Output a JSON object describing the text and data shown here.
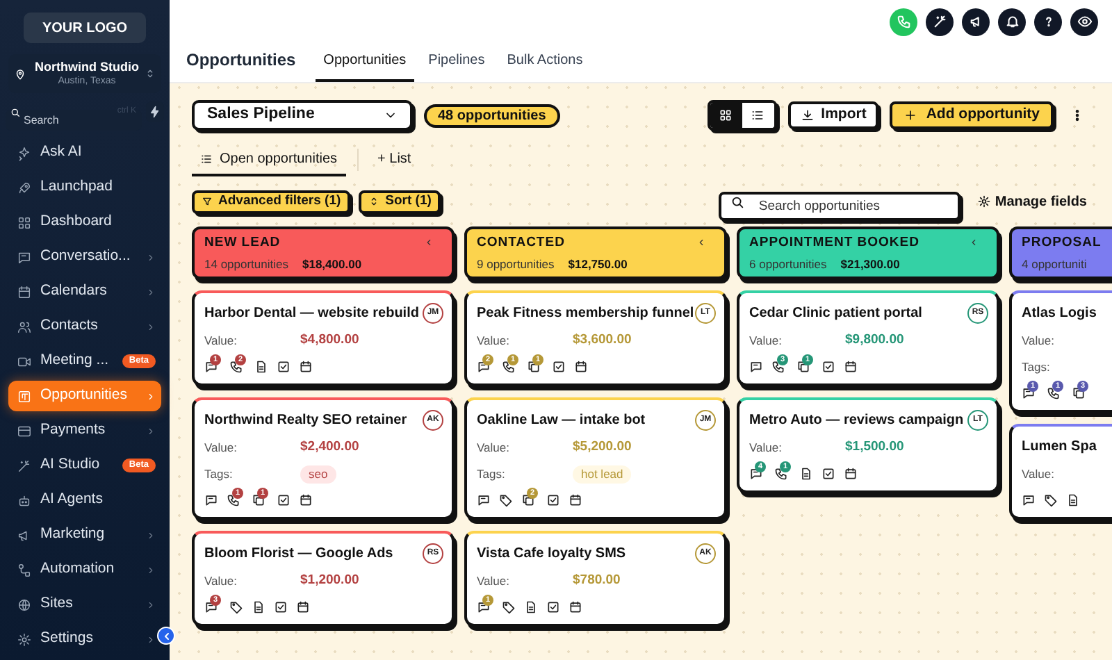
{
  "sidebar": {
    "logo": "YOUR LOGO",
    "location": {
      "name": "Northwind Studio",
      "address": "Austin, Texas"
    },
    "search": {
      "placeholder": "Search",
      "shortcut": "ctrl K"
    },
    "items": [
      {
        "label": "Ask AI",
        "chevron": false,
        "selected": false
      },
      {
        "label": "Launchpad",
        "chevron": false,
        "selected": false
      },
      {
        "label": "Dashboard",
        "chevron": false,
        "selected": false
      },
      {
        "label": "Conversatio...",
        "chevron": true,
        "selected": false
      },
      {
        "label": "Calendars",
        "chevron": true,
        "selected": false
      },
      {
        "label": "Contacts",
        "chevron": true,
        "selected": false
      },
      {
        "label": "Meeting ...",
        "chevron": false,
        "badge": "Beta",
        "selected": false
      },
      {
        "label": "Opportunities",
        "chevron": true,
        "selected": true
      },
      {
        "label": "Payments",
        "chevron": true,
        "selected": false
      },
      {
        "label": "AI Studio",
        "chevron": false,
        "badge": "Beta",
        "selected": false
      },
      {
        "label": "AI Agents",
        "chevron": false,
        "selected": false
      },
      {
        "label": "Marketing",
        "chevron": true,
        "selected": false
      },
      {
        "label": "Automation",
        "chevron": true,
        "selected": false
      },
      {
        "label": "Sites",
        "chevron": true,
        "selected": false
      },
      {
        "label": "Settings",
        "chevron": true,
        "selected": false
      }
    ]
  },
  "top_actions": [
    {
      "color": "#22c55e"
    },
    {
      "color": "#111827"
    },
    {
      "color": "#111827"
    },
    {
      "color": "#111827"
    },
    {
      "color": "#111827"
    },
    {
      "color": "#111827"
    }
  ],
  "page_title": "Opportunities",
  "tabs": [
    {
      "label": "Opportunities",
      "selected": true
    },
    {
      "label": "Pipelines",
      "selected": false
    },
    {
      "label": "Bulk Actions",
      "selected": false
    }
  ],
  "pipeline_select": "Sales Pipeline",
  "count_badge": "48 opportunities",
  "view_toggle": [
    {
      "selected": true
    },
    {
      "selected": false
    }
  ],
  "import_button": "Import",
  "add_button": "Add opportunity",
  "list_tabs": [
    {
      "label": "Open opportunities",
      "selected": true
    },
    {
      "label": "+ List",
      "selected": false
    }
  ],
  "filters": [
    "Advanced filters (1)",
    "Sort (1)"
  ],
  "search": {
    "placeholder": "Search opportunities"
  },
  "manage_fields": "Manage fields",
  "columns": [
    {
      "title": "NEW LEAD",
      "count": "14 opportunities",
      "total": "$18,400.00",
      "color": "#f85a5a",
      "cards": [
        {
          "title": "Harbor Dental — website rebuild",
          "owner": "JM",
          "value_label": "Value:",
          "value": "$4,800.00",
          "icons": [
            {
              "kind": "chat",
              "count": "1"
            },
            {
              "kind": "phone",
              "count": "2"
            },
            {
              "kind": "doc"
            },
            {
              "kind": "task"
            },
            {
              "kind": "calendar"
            }
          ]
        },
        {
          "title": "Northwind Realty SEO retainer",
          "owner": "AK",
          "value_label": "Value:",
          "value": "$2,400.00",
          "tags_label": "Tags:",
          "tags": [
            "seo"
          ],
          "icons": [
            {
              "kind": "chat"
            },
            {
              "kind": "phone",
              "count": "1"
            },
            {
              "kind": "copy",
              "count": "1"
            },
            {
              "kind": "task"
            },
            {
              "kind": "calendar"
            }
          ]
        },
        {
          "title": "Bloom Florist — Google Ads",
          "owner": "RS",
          "value_label": "Value:",
          "value": "$1,200.00",
          "icons": [
            {
              "kind": "chat",
              "count": "3"
            },
            {
              "kind": "tag"
            },
            {
              "kind": "doc"
            },
            {
              "kind": "task"
            },
            {
              "kind": "calendar"
            }
          ]
        }
      ]
    },
    {
      "title": "CONTACTED",
      "count": "9 opportunities",
      "total": "$12,750.00",
      "color": "#fcd34d",
      "cards": [
        {
          "title": "Peak Fitness membership funnel",
          "owner": "LT",
          "value_label": "Value:",
          "value": "$3,600.00",
          "icons": [
            {
              "kind": "chat",
              "count": "2"
            },
            {
              "kind": "phone",
              "count": "1"
            },
            {
              "kind": "copy",
              "count": "1"
            },
            {
              "kind": "task"
            },
            {
              "kind": "calendar"
            }
          ]
        },
        {
          "title": "Oakline Law — intake bot",
          "owner": "JM",
          "value_label": "Value:",
          "value": "$5,200.00",
          "tags_label": "Tags:",
          "tags": [
            "hot lead"
          ],
          "icons": [
            {
              "kind": "chat"
            },
            {
              "kind": "tag"
            },
            {
              "kind": "copy",
              "count": "2"
            },
            {
              "kind": "task"
            },
            {
              "kind": "calendar"
            }
          ]
        },
        {
          "title": "Vista Cafe loyalty SMS",
          "owner": "AK",
          "value_label": "Value:",
          "value": "$780.00",
          "icons": [
            {
              "kind": "chat",
              "count": "1"
            },
            {
              "kind": "tag"
            },
            {
              "kind": "doc"
            },
            {
              "kind": "task"
            },
            {
              "kind": "calendar"
            }
          ]
        }
      ]
    },
    {
      "title": "APPOINTMENT BOOKED",
      "count": "6 opportunities",
      "total": "$21,300.00",
      "color": "#34d1a5",
      "cards": [
        {
          "title": "Cedar Clinic patient portal",
          "owner": "RS",
          "value_label": "Value:",
          "value": "$9,800.00",
          "icons": [
            {
              "kind": "chat"
            },
            {
              "kind": "phone",
              "count": "3"
            },
            {
              "kind": "copy",
              "count": "1"
            },
            {
              "kind": "task"
            },
            {
              "kind": "calendar"
            }
          ]
        },
        {
          "title": "Metro Auto — reviews campaign",
          "owner": "LT",
          "value_label": "Value:",
          "value": "$1,500.00",
          "icons": [
            {
              "kind": "chat",
              "count": "4"
            },
            {
              "kind": "phone",
              "count": "1"
            },
            {
              "kind": "doc"
            },
            {
              "kind": "task"
            },
            {
              "kind": "calendar"
            }
          ]
        }
      ]
    },
    {
      "title": "PROPOSAL",
      "count": "4 opportuniti",
      "color": "#7c7cf0",
      "cards": [
        {
          "title": "Atlas Logis",
          "value_label": "Value:",
          "tags_label": "Tags:",
          "icons": [
            {
              "kind": "chat",
              "count": "1"
            },
            {
              "kind": "phone",
              "count": "1"
            },
            {
              "kind": "copy",
              "count": "3"
            }
          ]
        },
        {
          "title": "Lumen Spa",
          "value_label": "Value:",
          "icons": [
            {
              "kind": "chat"
            },
            {
              "kind": "tag"
            },
            {
              "kind": "doc"
            }
          ]
        }
      ]
    }
  ]
}
